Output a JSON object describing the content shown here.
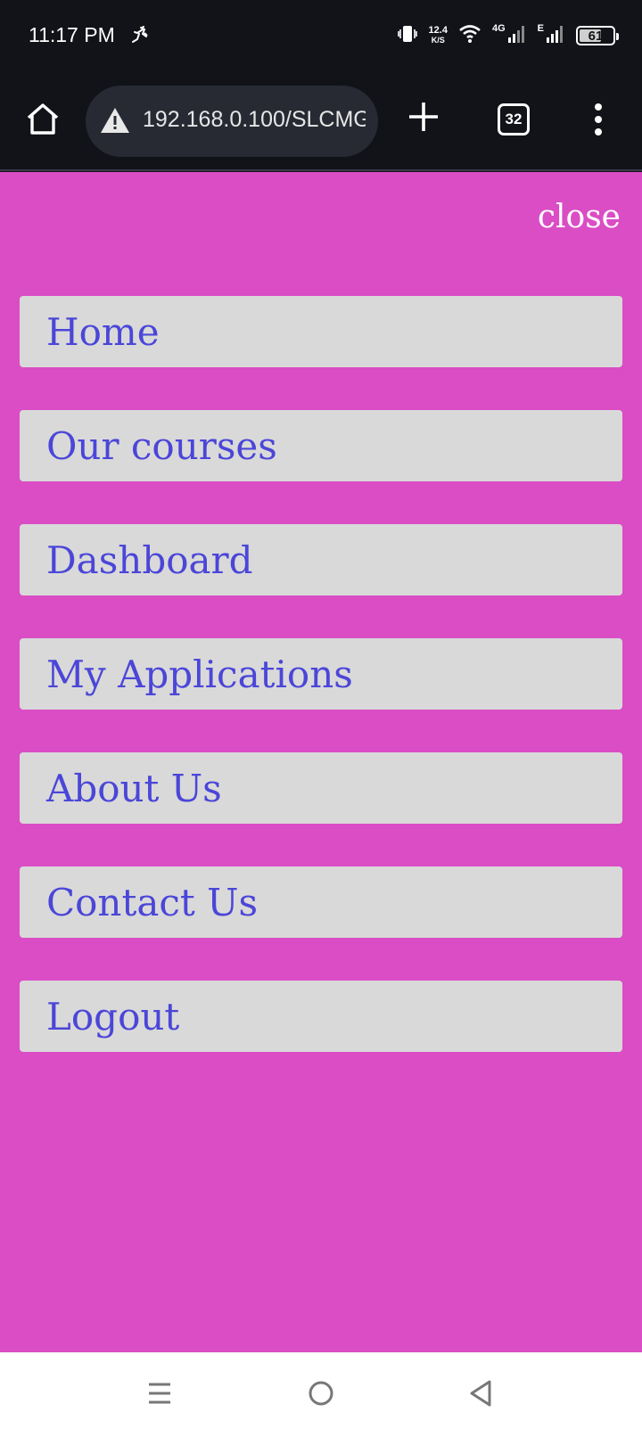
{
  "status_bar": {
    "time": "11:17 PM",
    "net_speed_value": "12.4",
    "net_speed_unit": "K/S",
    "network_type_1": "4G",
    "network_type_2": "E",
    "battery": "61",
    "icons": [
      "activity-icon",
      "vibrate-icon",
      "wifi-icon",
      "signal-icon",
      "battery-icon"
    ]
  },
  "browser": {
    "url": "192.168.0.100/SLCMG",
    "tab_count": "32",
    "icons": [
      "home-icon",
      "warning-icon",
      "new-tab-icon",
      "tabs-icon",
      "more-icon"
    ]
  },
  "drawer": {
    "close_label": "close",
    "items": [
      {
        "label": "Home"
      },
      {
        "label": "Our courses"
      },
      {
        "label": "Dashboard"
      },
      {
        "label": "My Applications"
      },
      {
        "label": "About Us"
      },
      {
        "label": "Contact Us"
      },
      {
        "label": "Logout"
      }
    ]
  },
  "colors": {
    "page_background": "#da4dc5",
    "menu_item_background": "#d9d9d9",
    "menu_item_text": "#4b46d8",
    "close_text": "#ffffff"
  },
  "nav_bar": {
    "icons": [
      "recents-icon",
      "home-circle-icon",
      "back-icon"
    ]
  }
}
